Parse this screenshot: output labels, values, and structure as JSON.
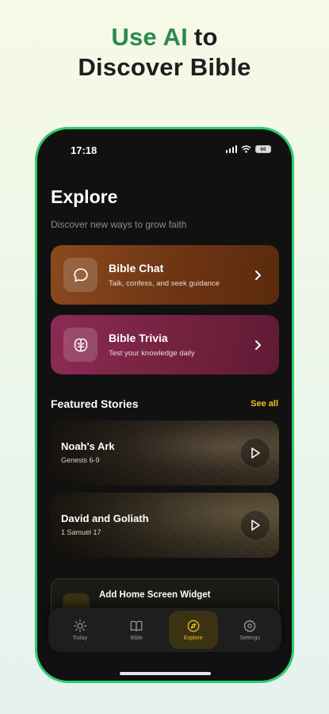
{
  "promo": {
    "line1_accent": "Use AI",
    "line1_rest": "to",
    "line2": "Discover Bible"
  },
  "status_bar": {
    "time": "17:18",
    "battery": "66"
  },
  "page": {
    "title": "Explore",
    "subtitle": "Discover new ways to grow faith"
  },
  "cards": [
    {
      "title": "Bible Chat",
      "subtitle": "Talk, confess, and seek guidance",
      "icon": "chat-bubble-icon"
    },
    {
      "title": "Bible Trivia",
      "subtitle": "Test your knowledge daily",
      "icon": "brain-icon"
    }
  ],
  "featured": {
    "heading": "Featured Stories",
    "see_all": "See all",
    "stories": [
      {
        "title": "Noah's Ark",
        "reference": "Genesis 6-9"
      },
      {
        "title": "David and Goliath",
        "reference": "1 Samuel 17"
      }
    ]
  },
  "widget": {
    "title": "Add Home Screen Widget"
  },
  "tabs": [
    {
      "label": "Today",
      "icon": "sun-icon",
      "active": false
    },
    {
      "label": "Bible",
      "icon": "book-icon",
      "active": false
    },
    {
      "label": "Explore",
      "icon": "compass-icon",
      "active": true
    },
    {
      "label": "Settings",
      "icon": "gear-icon",
      "active": false
    }
  ],
  "colors": {
    "accent_green": "#2a8a4a",
    "phone_border": "#2ecc6e",
    "gold": "#f2c21b",
    "chat_card": "#7a3f18",
    "trivia_card": "#7c2546"
  }
}
